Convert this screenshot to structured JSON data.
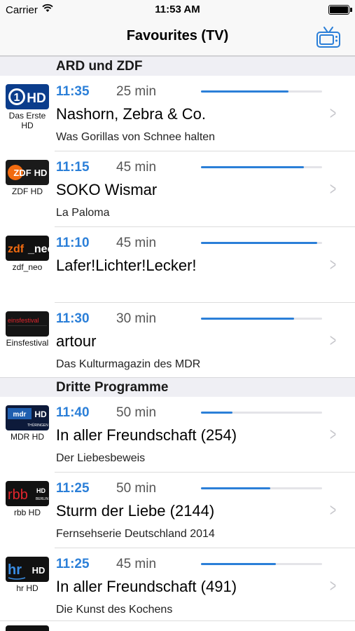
{
  "status_bar": {
    "carrier": "Carrier",
    "time": "11:53 AM",
    "battery_percent": 100
  },
  "nav": {
    "title": "Favourites (TV)",
    "tv_icon": "tv-icon"
  },
  "colors": {
    "accent": "#2b7fd8",
    "section_bg": "#efeff4",
    "chevron": "#c7c7cc"
  },
  "sections": [
    {
      "title": "ARD und ZDF",
      "rows": [
        {
          "channel": "Das Erste HD",
          "logo": "das-erste-hd-logo",
          "time": "11:35",
          "duration": "25 min",
          "progress": 0.72,
          "title": "Nashorn, Zebra & Co.",
          "subtitle": "Was Gorillas von Schnee halten"
        },
        {
          "channel": "ZDF HD",
          "logo": "zdf-hd-logo",
          "time": "11:15",
          "duration": "45 min",
          "progress": 0.85,
          "title": "SOKO Wismar",
          "subtitle": "La Paloma"
        },
        {
          "channel": "zdf_neo",
          "logo": "zdf-neo-logo",
          "time": "11:10",
          "duration": "45 min",
          "progress": 0.96,
          "title": "Lafer!Lichter!Lecker!",
          "subtitle": ""
        },
        {
          "channel": "Einsfestival",
          "logo": "einsfestival-logo",
          "time": "11:30",
          "duration": "30 min",
          "progress": 0.77,
          "title": "artour",
          "subtitle": "Das Kulturmagazin des MDR"
        }
      ]
    },
    {
      "title": "Dritte Programme",
      "rows": [
        {
          "channel": "MDR HD",
          "logo": "mdr-hd-logo",
          "time": "11:40",
          "duration": "50 min",
          "progress": 0.26,
          "title": "In aller Freundschaft (254)",
          "subtitle": "Der Liebesbeweis"
        },
        {
          "channel": "rbb HD",
          "logo": "rbb-hd-logo",
          "time": "11:25",
          "duration": "50 min",
          "progress": 0.57,
          "title": "Sturm der Liebe (2144)",
          "subtitle": "Fernsehserie Deutschland 2014"
        },
        {
          "channel": "hr HD",
          "logo": "hr-hd-logo",
          "time": "11:25",
          "duration": "45 min",
          "progress": 0.62,
          "title": "In aller Freundschaft (491)",
          "subtitle": "Die Kunst des Kochens"
        }
      ]
    }
  ]
}
